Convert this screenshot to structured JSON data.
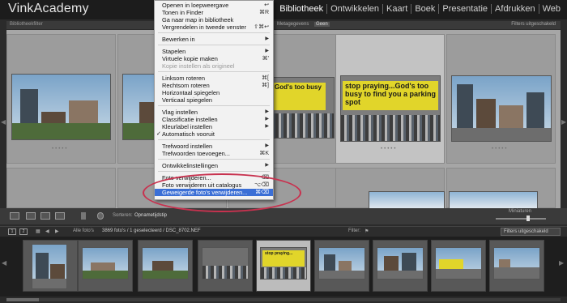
{
  "app": {
    "title": "VinkAcademy"
  },
  "modules": [
    "Bibliotheek",
    "Ontwikkelen",
    "Kaart",
    "Boek",
    "Presentatie",
    "Afdrukken",
    "Web"
  ],
  "filterbar": {
    "label": "Bibliotheekfilter",
    "options": [
      "Metagegevens",
      "Geen"
    ],
    "right": "Filters uitgeschakeld"
  },
  "menu": {
    "items": [
      {
        "label": "Openen in loepweergave",
        "shortcut": "↩"
      },
      {
        "label": "Tonen in Finder",
        "shortcut": "⌘R"
      },
      {
        "label": "Ga naar map in bibliotheek",
        "shortcut": ""
      },
      {
        "label": "Vergrendelen in tweede venster",
        "shortcut": "⇧⌘↩"
      },
      {
        "label": "Bewerken in",
        "shortcut": "▶"
      },
      {
        "label": "Stapelen",
        "shortcut": "▶"
      },
      {
        "label": "Virtuele kopie maken",
        "shortcut": "⌘'"
      },
      {
        "label": "Kopie instellen als origineel",
        "shortcut": ""
      },
      {
        "label": "Linksom roteren",
        "shortcut": "⌘["
      },
      {
        "label": "Rechtsom roteren",
        "shortcut": "⌘]"
      },
      {
        "label": "Horizontaal spiegelen",
        "shortcut": ""
      },
      {
        "label": "Verticaal spiegelen",
        "shortcut": ""
      },
      {
        "label": "Vlag instellen",
        "shortcut": "▶"
      },
      {
        "label": "Classificatie instellen",
        "shortcut": "▶"
      },
      {
        "label": "Kleurlabel instellen",
        "shortcut": "▶"
      },
      {
        "label": "Automatisch vooruit",
        "shortcut": ""
      },
      {
        "label": "Trefwoord instellen",
        "shortcut": "▶"
      },
      {
        "label": "Trefwoorden toevoegen...",
        "shortcut": "⌘K"
      },
      {
        "label": "Ontwikkelinstellingen",
        "shortcut": "▶"
      },
      {
        "label": "Foto verwijderen...",
        "shortcut": "⌫"
      },
      {
        "label": "Foto verwijderen uit catalogus",
        "shortcut": "⌥⌫"
      },
      {
        "label": "Geweigerde foto's verwijderen...",
        "shortcut": "⌘⌫"
      }
    ]
  },
  "grid": {
    "billboard": "stop praying...God's too busy to find you a parking spot"
  },
  "toolbar": {
    "sort_label": "Sorteren:",
    "sort_value": "Opnametijdstip",
    "thumbnails_label": "Miniaturen"
  },
  "filmstrip": {
    "pages": [
      "1",
      "2"
    ],
    "source": "Alle foto's",
    "status": "3869 foto's / 1 geselecteerd / DSC_8702.NEF",
    "filter_label": "Filter:",
    "filter_value": "Filters uitgeschakeld"
  },
  "colors": {
    "highlight": "#3b6fd6",
    "ring": "#c8324f",
    "billboard": "#e1d52a"
  }
}
